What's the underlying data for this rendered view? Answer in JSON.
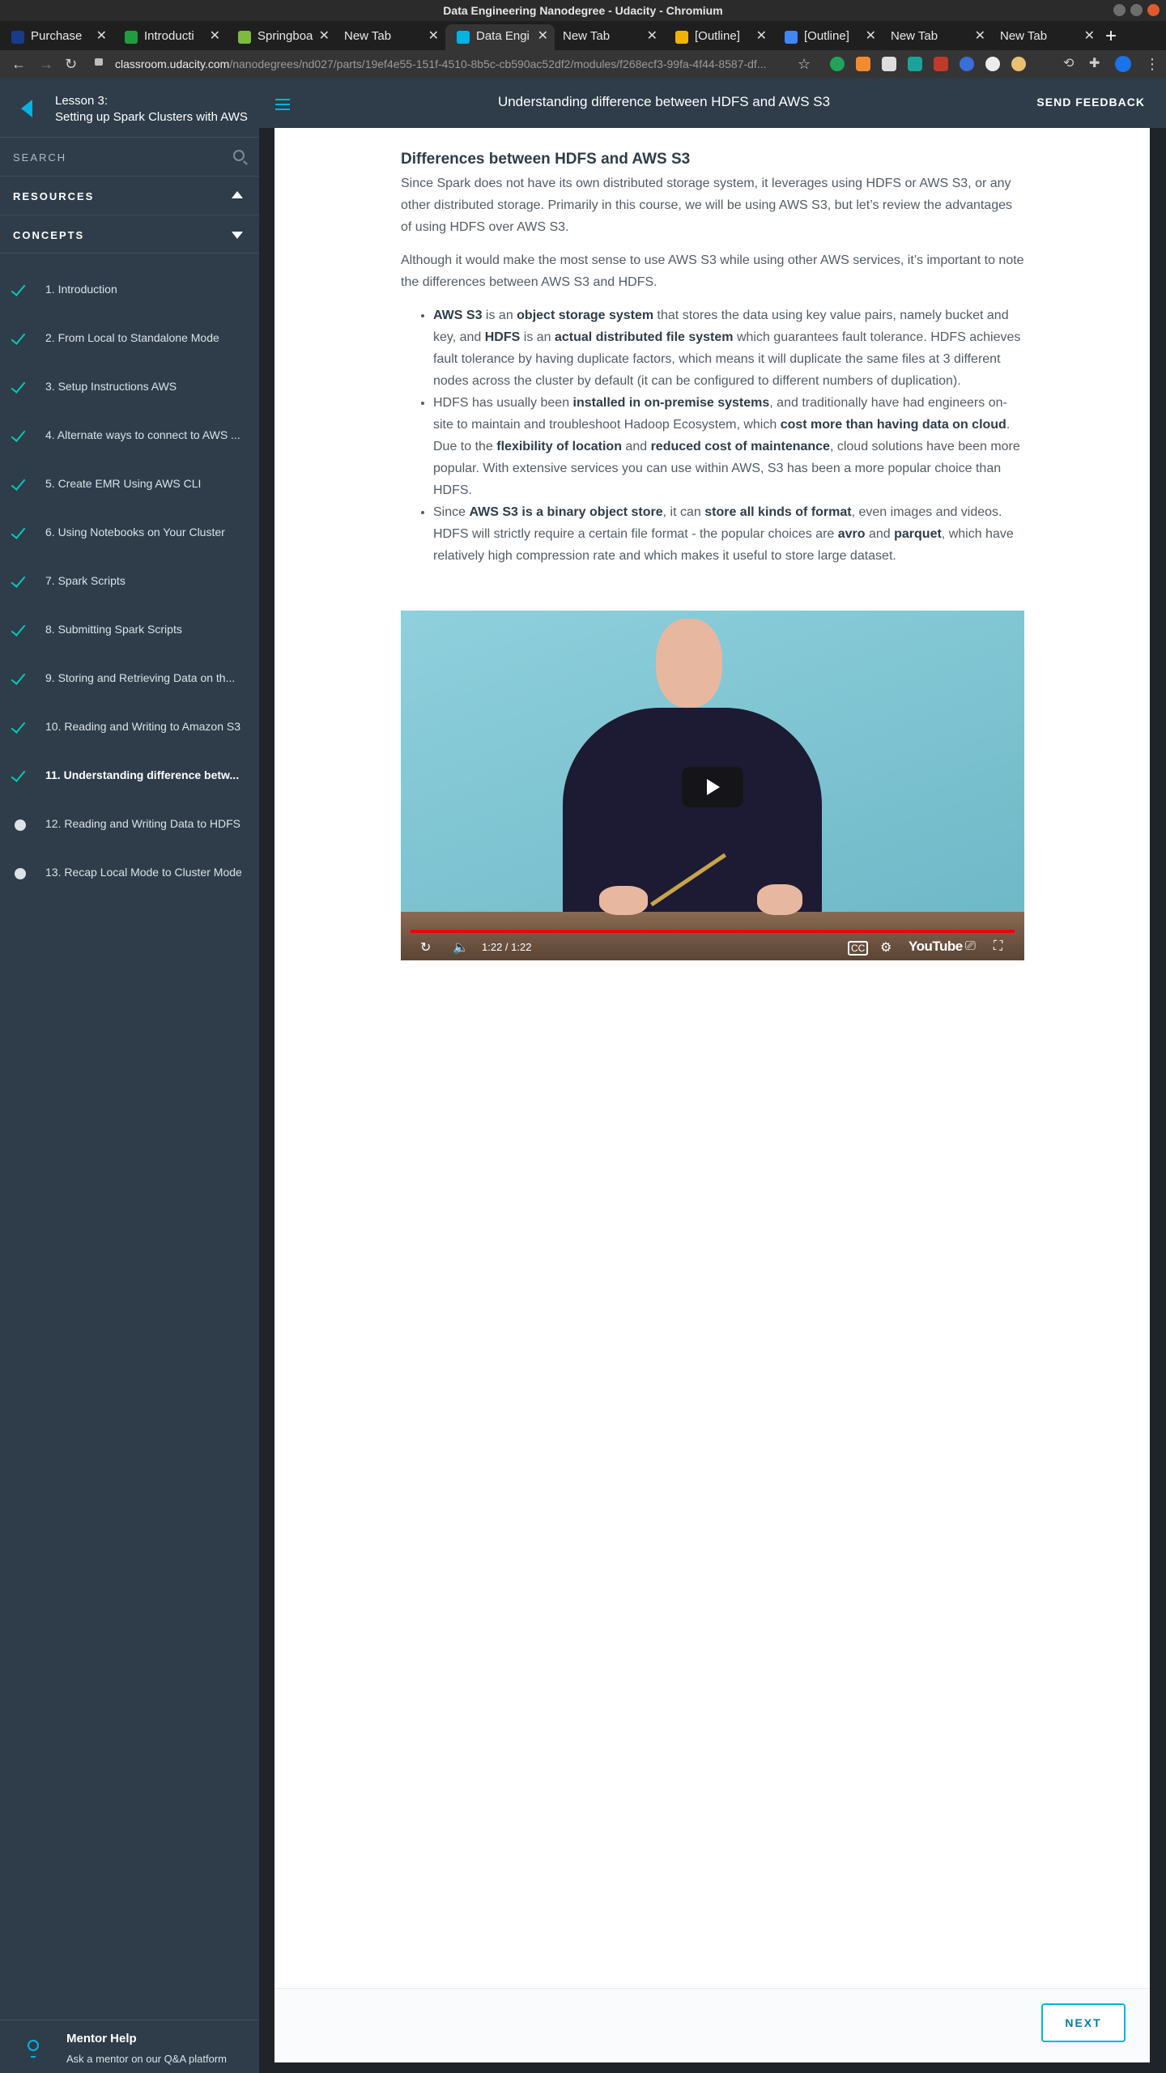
{
  "window": {
    "title": "Data Engineering Nanodegree - Udacity - Chromium"
  },
  "tabs": [
    {
      "label": "Purchase",
      "color": "#1a3a8c"
    },
    {
      "label": "Introducti",
      "color": "#1f9e3e"
    },
    {
      "label": "Springboa",
      "color": "#7dbb3f"
    },
    {
      "label": "New Tab",
      "color": ""
    },
    {
      "label": "Data Engi",
      "color": "#02b3e4"
    },
    {
      "label": "New Tab",
      "color": ""
    },
    {
      "label": "[Outline]",
      "color": "#f0b400"
    },
    {
      "label": "[Outline]",
      "color": "#4285f4"
    },
    {
      "label": "New Tab",
      "color": ""
    },
    {
      "label": "New Tab",
      "color": ""
    }
  ],
  "address": {
    "host": "classroom.udacity.com",
    "path": "/nanodegrees/nd027/parts/19ef4e55-151f-4510-8b5c-cb590ac52df2/modules/f268ecf3-99fa-4f44-8587-df..."
  },
  "sidebar": {
    "lesson_number": "Lesson 3:",
    "lesson_title": "Setting up Spark Clusters with AWS",
    "search_label": "SEARCH",
    "resources_label": "RESOURCES",
    "concepts_label": "CONCEPTS",
    "concepts": [
      {
        "label": "1. Introduction",
        "state": "done"
      },
      {
        "label": "2. From Local to Standalone Mode",
        "state": "done"
      },
      {
        "label": "3. Setup Instructions AWS",
        "state": "done"
      },
      {
        "label": "4. Alternate ways to connect to AWS ...",
        "state": "done"
      },
      {
        "label": "5. Create EMR Using AWS CLI",
        "state": "done"
      },
      {
        "label": "6. Using Notebooks on Your Cluster",
        "state": "done"
      },
      {
        "label": "7. Spark Scripts",
        "state": "done"
      },
      {
        "label": "8. Submitting Spark Scripts",
        "state": "done"
      },
      {
        "label": "9. Storing and Retrieving Data on th...",
        "state": "done"
      },
      {
        "label": "10. Reading and Writing to Amazon S3",
        "state": "done"
      },
      {
        "label": "11. Understanding difference betw...",
        "state": "active"
      },
      {
        "label": "12. Reading and Writing Data to HDFS",
        "state": "todo"
      },
      {
        "label": "13. Recap Local Mode to Cluster Mode",
        "state": "todo"
      }
    ],
    "mentor_title": "Mentor Help",
    "mentor_subtitle": "Ask a mentor on our Q&A platform"
  },
  "header": {
    "title": "Understanding difference between HDFS and AWS S3",
    "feedback_label": "SEND FEEDBACK"
  },
  "article": {
    "heading": "Differences between HDFS and AWS S3",
    "para1": "Since Spark does not have its own distributed storage system, it leverages using HDFS or AWS S3, or any other distributed storage. Primarily in this course, we will be using AWS S3, but let’s review the advantages of using HDFS over AWS S3.",
    "para2": "Although it would make the most sense to use AWS S3 while using other AWS services, it’s important to note the differences between AWS S3 and HDFS.",
    "b1": {
      "t1": "AWS S3",
      "t2": " is an ",
      "t3": "object storage system",
      "t4": " that stores the data using key value pairs, namely bucket and key, and ",
      "t5": "HDFS",
      "t6": " is an ",
      "t7": "actual distributed file system",
      "t8": " which guarantees fault tolerance. HDFS achieves fault tolerance by having duplicate factors, which means it will duplicate the same files at 3 different nodes across the cluster by default (it can be configured to different numbers of duplication)."
    },
    "b2": {
      "t1": "HDFS has usually been ",
      "t2": "installed in on-premise systems",
      "t3": ", and traditionally have had engineers on-site to maintain and troubleshoot Hadoop Ecosystem, which ",
      "t4": "cost more than having data on cloud",
      "t5": ". Due to the ",
      "t6": "flexibility of location",
      "t7": " and ",
      "t8": "reduced cost of maintenance",
      "t9": ", cloud solutions have been more popular. With extensive services you can use within AWS, S3 has been a more popular choice than HDFS."
    },
    "b3": {
      "t1": "Since ",
      "t2": "AWS S3 is a binary object store",
      "t3": ", it can ",
      "t4": "store all kinds of format",
      "t5": ", even images and videos. HDFS will strictly require a certain file format - the popular choices are ",
      "t6": "avro",
      "t7": " and ",
      "t8": "parquet",
      "t9": ", which have relatively high compression rate and which makes it useful to store large dataset."
    }
  },
  "video": {
    "time": "1:22 / 1:22",
    "brand": "YouTube",
    "progress": 1.0
  },
  "footer": {
    "next_label": "NEXT"
  }
}
